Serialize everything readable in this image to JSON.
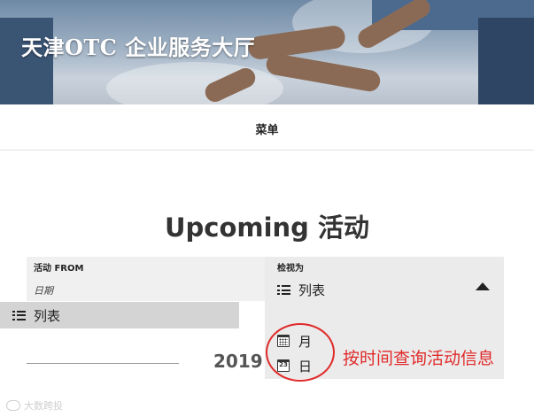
{
  "hero": {
    "title": "天津OTC 企业服务大厅"
  },
  "nav": {
    "menu_label": "菜单"
  },
  "events": {
    "heading": "Upcoming 活动",
    "filter_label": "活动 FROM",
    "date_placeholder": "日期",
    "view_label": "检视为",
    "selected_view": "列表",
    "view_options": [
      {
        "label": "列表",
        "icon": "list-icon"
      },
      {
        "label": "月",
        "icon": "calendar-month-icon"
      },
      {
        "label": "日",
        "icon": "calendar-day-icon"
      }
    ],
    "day_icon_number": "23",
    "year_partial": "2019"
  },
  "annotation": {
    "text": "按时间查询活动信息",
    "color": "#e02a2a"
  },
  "watermark": {
    "text": "大数跨投"
  }
}
